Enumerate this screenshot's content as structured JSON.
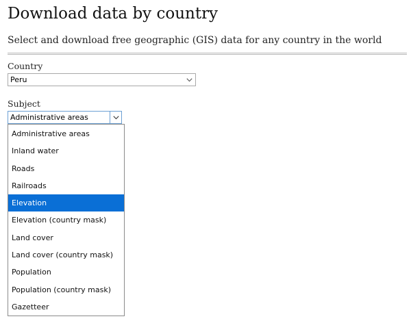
{
  "header": {
    "title": "Download data by country",
    "subtitle": "Select and download free geographic (GIS) data for any country in the world"
  },
  "form": {
    "country": {
      "label": "Country",
      "value": "Peru"
    },
    "subject": {
      "label": "Subject",
      "value": "Administrative areas",
      "options": [
        "Administrative areas",
        "Inland water",
        "Roads",
        "Railroads",
        "Elevation",
        "Elevation (country mask)",
        "Land cover",
        "Land cover (country mask)",
        "Population",
        "Population (country mask)",
        "Gazetteer"
      ],
      "highlighted_option": "Elevation"
    }
  },
  "colors": {
    "highlight": "#0a6fd6",
    "focus_border": "#6b9fd4"
  },
  "icons": {
    "select_arrow": "chevron-down-icon"
  }
}
